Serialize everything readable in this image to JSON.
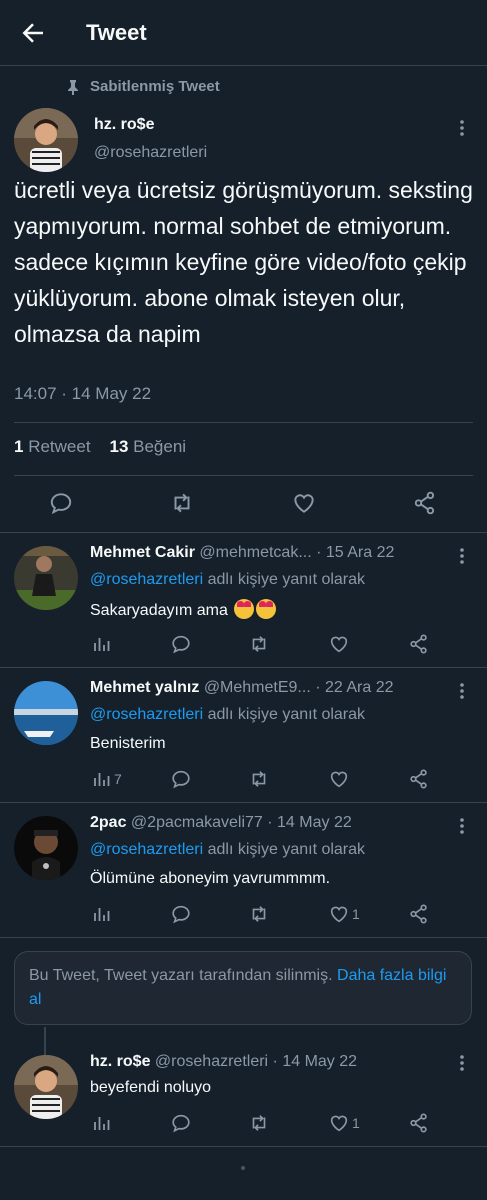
{
  "header": {
    "title": "Tweet"
  },
  "pinned_label": "Sabitlenmiş Tweet",
  "main_tweet": {
    "name": "hz. ro$e",
    "handle": "@rosehazretleri",
    "text": "ücretli veya ücretsiz görüşmüyorum. seksting yapmıyorum. normal sohbet de etmiyorum. sadece kıçımın keyfine göre video/foto çekip yüklüyorum. abone olmak isteyen olur, olmazsa da napim",
    "time": "14:07 · 14 May 22",
    "retweet_count": "1",
    "retweet_label": "Retweet",
    "like_count": "13",
    "like_label": "Beğeni"
  },
  "replying_suffix": "adlı kişiye yanıt olarak",
  "replying_handle": "@rosehazretleri",
  "replies": [
    {
      "name": "Mehmet Cakir",
      "handle": "@mehmetcak...",
      "date": "· 15 Ara 22",
      "text": "Sakaryadayım ama",
      "views": "",
      "likes": ""
    },
    {
      "name": "Mehmet yalnız",
      "handle": "@MehmetE9...",
      "date": "· 22 Ara 22",
      "text": "Benisterim",
      "views": "7",
      "likes": ""
    },
    {
      "name": "2pac",
      "handle": "@2pacmakaveli77",
      "date": "· 14 May 22",
      "text": "Ölümüne aboneyim yavrummmm.",
      "views": "",
      "likes": "1"
    }
  ],
  "deleted_notice": {
    "text": "Bu Tweet, Tweet yazarı tarafından silinmiş.",
    "link": "Daha fazla bilgi al"
  },
  "self_reply": {
    "name": "hz. ro$e",
    "handle": "@rosehazretleri",
    "date": "· 14 May 22",
    "text": "beyefendi noluyo",
    "likes": "1"
  },
  "colors": {
    "background": "#15202b",
    "accent": "#1d9bf0",
    "muted": "#8b98a5",
    "divider": "#38444d"
  }
}
